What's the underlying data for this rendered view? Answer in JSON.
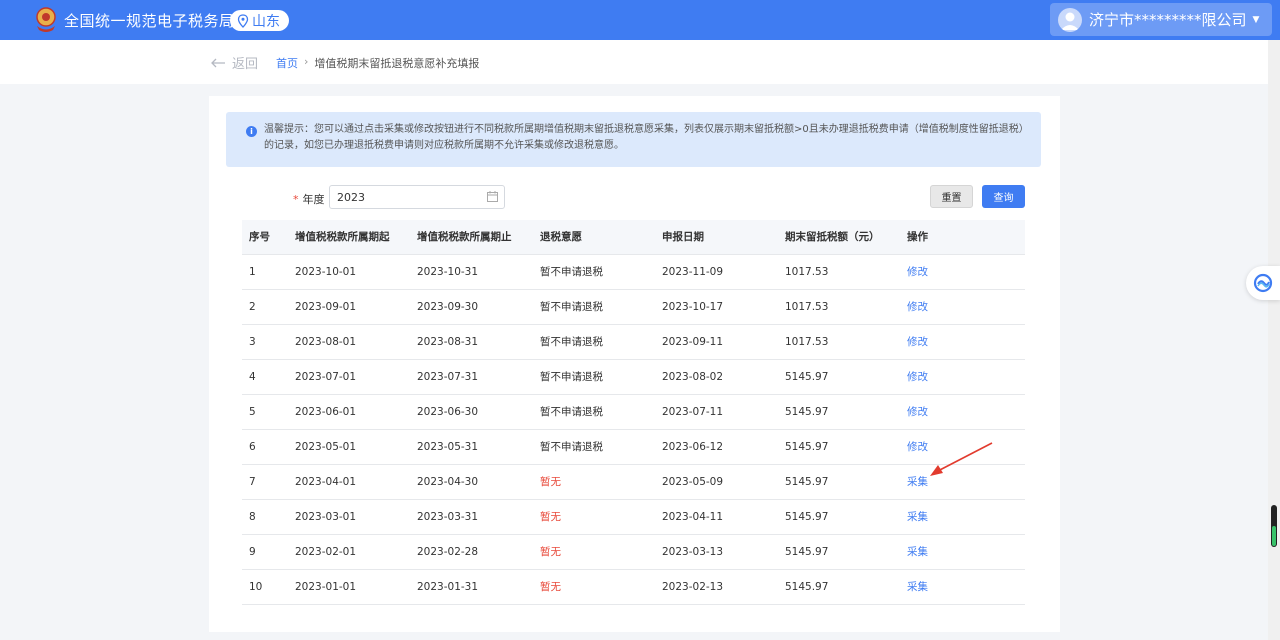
{
  "header": {
    "site_title": "全国统一规范电子税务局",
    "region": "山东",
    "account_name": "济宁市*********限公司",
    "brand_color": "#3f7cf2",
    "icons": {
      "logo": "tax-emblem-icon",
      "region": "location-pin-icon",
      "avatar": "user-avatar-icon",
      "caret": "caret-down-icon"
    }
  },
  "breadcrumb": {
    "back_label": "返回",
    "home": "首页",
    "separator": "›",
    "current": "增值税期末留抵退税意愿补充填报"
  },
  "tip": {
    "text": "温馨提示：您可以通过点击采集或修改按钮进行不同税款所属期增值税期末留抵退税意愿采集，列表仅展示期末留抵税额>0且未办理退抵税费申请（增值税制度性留抵退税）的记录，如您已办理退抵税费申请则对应税款所属期不允许采集或修改退税意愿。"
  },
  "filter": {
    "required_mark": "*",
    "year_label": "年度",
    "year_value": "2023",
    "reset_label": "重置",
    "query_label": "查询"
  },
  "table": {
    "headers": [
      "序号",
      "增值税税款所属期起",
      "增值税税款所属期止",
      "退税意愿",
      "申报日期",
      "期末留抵税额（元）",
      "操作"
    ],
    "rows": [
      {
        "no": "1",
        "start": "2023-10-01",
        "end": "2023-10-31",
        "intent": "暂不申请退税",
        "date": "2023-11-09",
        "amount": "1017.53",
        "action": "修改"
      },
      {
        "no": "2",
        "start": "2023-09-01",
        "end": "2023-09-30",
        "intent": "暂不申请退税",
        "date": "2023-10-17",
        "amount": "1017.53",
        "action": "修改"
      },
      {
        "no": "3",
        "start": "2023-08-01",
        "end": "2023-08-31",
        "intent": "暂不申请退税",
        "date": "2023-09-11",
        "amount": "1017.53",
        "action": "修改"
      },
      {
        "no": "4",
        "start": "2023-07-01",
        "end": "2023-07-31",
        "intent": "暂不申请退税",
        "date": "2023-08-02",
        "amount": "5145.97",
        "action": "修改"
      },
      {
        "no": "5",
        "start": "2023-06-01",
        "end": "2023-06-30",
        "intent": "暂不申请退税",
        "date": "2023-07-11",
        "amount": "5145.97",
        "action": "修改"
      },
      {
        "no": "6",
        "start": "2023-05-01",
        "end": "2023-05-31",
        "intent": "暂不申请退税",
        "date": "2023-06-12",
        "amount": "5145.97",
        "action": "修改"
      },
      {
        "no": "7",
        "start": "2023-04-01",
        "end": "2023-04-30",
        "intent": "暂无",
        "date": "2023-05-09",
        "amount": "5145.97",
        "action": "采集"
      },
      {
        "no": "8",
        "start": "2023-03-01",
        "end": "2023-03-31",
        "intent": "暂无",
        "date": "2023-04-11",
        "amount": "5145.97",
        "action": "采集"
      },
      {
        "no": "9",
        "start": "2023-02-01",
        "end": "2023-02-28",
        "intent": "暂无",
        "date": "2023-03-13",
        "amount": "5145.97",
        "action": "采集"
      },
      {
        "no": "10",
        "start": "2023-01-01",
        "end": "2023-01-31",
        "intent": "暂无",
        "date": "2023-02-13",
        "amount": "5145.97",
        "action": "采集"
      }
    ]
  },
  "colors": {
    "intent_none": "#e84a3b",
    "link": "#3f7cf2"
  }
}
